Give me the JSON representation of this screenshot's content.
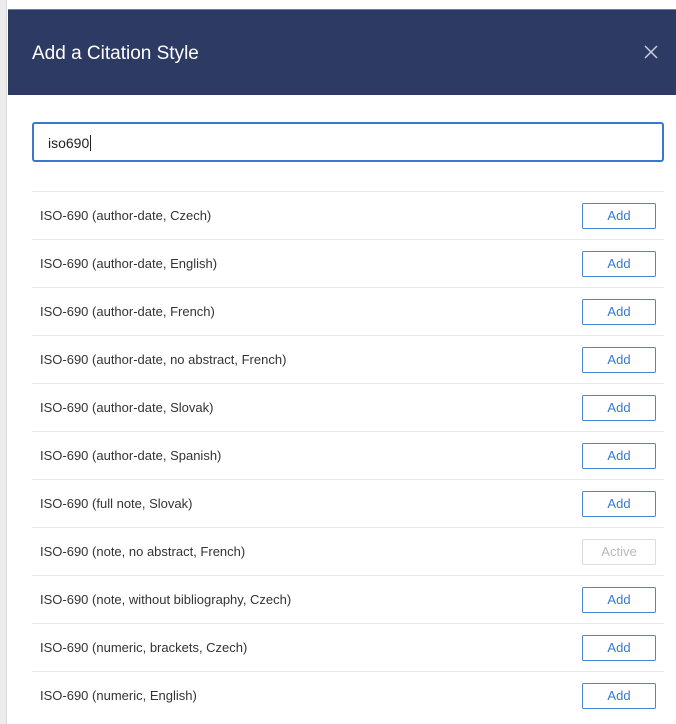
{
  "dialog": {
    "title": "Add a Citation Style",
    "close_icon": "close-icon"
  },
  "search": {
    "value": "iso690"
  },
  "styles": [
    {
      "label": "ISO-690 (author-date, Czech)",
      "button": "Add",
      "state": "add"
    },
    {
      "label": "ISO-690 (author-date, English)",
      "button": "Add",
      "state": "add"
    },
    {
      "label": "ISO-690 (author-date, French)",
      "button": "Add",
      "state": "add"
    },
    {
      "label": "ISO-690 (author-date, no abstract, French)",
      "button": "Add",
      "state": "add"
    },
    {
      "label": "ISO-690 (author-date, Slovak)",
      "button": "Add",
      "state": "add"
    },
    {
      "label": "ISO-690 (author-date, Spanish)",
      "button": "Add",
      "state": "add"
    },
    {
      "label": "ISO-690 (full note, Slovak)",
      "button": "Add",
      "state": "add"
    },
    {
      "label": "ISO-690 (note, no abstract, French)",
      "button": "Active",
      "state": "active"
    },
    {
      "label": "ISO-690 (note, without bibliography, Czech)",
      "button": "Add",
      "state": "add"
    },
    {
      "label": "ISO-690 (numeric, brackets, Czech)",
      "button": "Add",
      "state": "add"
    },
    {
      "label": "ISO-690 (numeric, English)",
      "button": "Add",
      "state": "add"
    }
  ],
  "colors": {
    "header_bg": "#2d3a63",
    "accent": "#3a78d0",
    "disabled": "#b9b9b9"
  }
}
